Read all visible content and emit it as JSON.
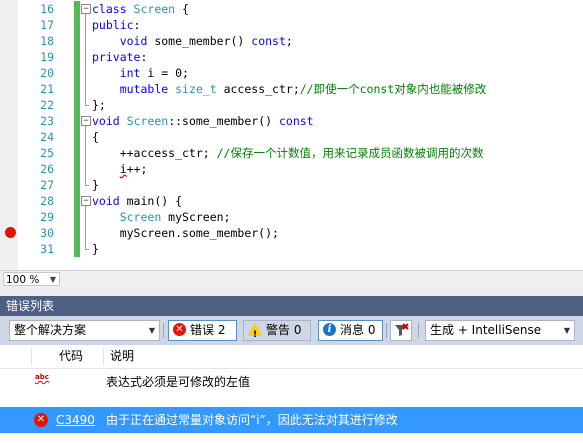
{
  "editor": {
    "lines": [
      {
        "n": "16",
        "fold": "minus",
        "parts": [
          {
            "c": "kw",
            "t": "class "
          },
          {
            "c": "ty",
            "t": "Screen"
          },
          {
            "c": "tx",
            "t": " {"
          }
        ]
      },
      {
        "n": "17",
        "parts": [
          {
            "c": "kw",
            "t": "public"
          },
          {
            "c": "tx",
            "t": ":"
          }
        ]
      },
      {
        "n": "18",
        "parts": [
          {
            "c": "tx",
            "t": "    "
          },
          {
            "c": "kw",
            "t": "void"
          },
          {
            "c": "tx",
            "t": " some_member() "
          },
          {
            "c": "kw",
            "t": "const"
          },
          {
            "c": "tx",
            "t": ";"
          }
        ]
      },
      {
        "n": "19",
        "parts": [
          {
            "c": "kw",
            "t": "private"
          },
          {
            "c": "tx",
            "t": ":"
          }
        ]
      },
      {
        "n": "20",
        "parts": [
          {
            "c": "tx",
            "t": "    "
          },
          {
            "c": "kw",
            "t": "int"
          },
          {
            "c": "tx",
            "t": " i = 0;"
          }
        ]
      },
      {
        "n": "21",
        "parts": [
          {
            "c": "tx",
            "t": "    "
          },
          {
            "c": "kw",
            "t": "mutable"
          },
          {
            "c": "tx",
            "t": " "
          },
          {
            "c": "ty",
            "t": "size_t"
          },
          {
            "c": "tx",
            "t": " access_ctr;"
          },
          {
            "c": "cm",
            "t": "//即使一个const对象内也能被修改"
          }
        ]
      },
      {
        "n": "22",
        "parts": [
          {
            "c": "tx",
            "t": "};"
          }
        ]
      },
      {
        "n": "23",
        "fold": "minus",
        "parts": [
          {
            "c": "kw",
            "t": "void"
          },
          {
            "c": "tx",
            "t": " "
          },
          {
            "c": "ty",
            "t": "Screen"
          },
          {
            "c": "tx",
            "t": "::some_member() "
          },
          {
            "c": "kw",
            "t": "const"
          }
        ]
      },
      {
        "n": "24",
        "parts": [
          {
            "c": "tx",
            "t": "{"
          }
        ]
      },
      {
        "n": "25",
        "parts": [
          {
            "c": "tx",
            "t": "    ++access_ctr; "
          },
          {
            "c": "cm",
            "t": "//保存一个计数值，用来记录成员函数被调用的次数"
          }
        ]
      },
      {
        "n": "26",
        "parts": [
          {
            "c": "tx",
            "t": "    "
          },
          {
            "c": "tx squiggle",
            "t": "i"
          },
          {
            "c": "tx",
            "t": "++;"
          }
        ]
      },
      {
        "n": "27",
        "parts": [
          {
            "c": "tx",
            "t": "}"
          }
        ]
      },
      {
        "n": "28",
        "fold": "minus",
        "parts": [
          {
            "c": "kw",
            "t": "void"
          },
          {
            "c": "tx",
            "t": " main() {"
          }
        ]
      },
      {
        "n": "29",
        "parts": [
          {
            "c": "tx",
            "t": "    "
          },
          {
            "c": "ty",
            "t": "Screen"
          },
          {
            "c": "tx",
            "t": " myScreen;"
          }
        ]
      },
      {
        "n": "30",
        "breakpoint": true,
        "parts": [
          {
            "c": "tx",
            "t": "    myScreen.some_member();"
          }
        ]
      },
      {
        "n": "31",
        "parts": [
          {
            "c": "tx",
            "t": "}"
          }
        ]
      }
    ],
    "zoom": "100 %"
  },
  "error_list": {
    "title": "错误列表",
    "scope": "整个解决方案",
    "errors_label": "错误 2",
    "warnings_label": "警告 0",
    "messages_label": "消息 0",
    "build_filter": "生成 + IntelliSense",
    "columns": {
      "code": "代码",
      "description": "说明"
    },
    "rows": [
      {
        "icon": "intellisense-abc-icon",
        "icon_text": "abc",
        "code": "",
        "description": "表达式必须是可修改的左值",
        "selected": false
      },
      {
        "icon": "error-icon",
        "code": "C3490",
        "description": "由于正在通过常量对象访问“i”，因此无法对其进行修改",
        "selected": true
      }
    ]
  }
}
